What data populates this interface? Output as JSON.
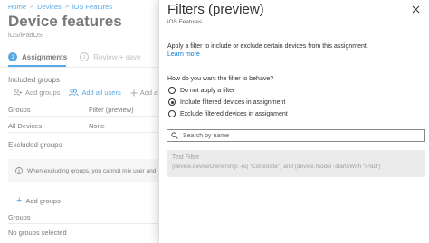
{
  "breadcrumb": [
    "Home",
    "Devices",
    "iOS Features"
  ],
  "page": {
    "title": "Device features",
    "more": "...",
    "subtitle": "iOS/iPadOS"
  },
  "steps": [
    {
      "num": "1",
      "label": "Assignments"
    },
    {
      "num": "2",
      "label": "Review + save"
    }
  ],
  "included": {
    "label": "Included groups",
    "actions": [
      "Add groups",
      "Add all users",
      "Add all d"
    ],
    "columns": [
      "Groups",
      "Filter (preview)"
    ],
    "rows": [
      {
        "group": "All Devices",
        "filter": "None"
      }
    ]
  },
  "excluded": {
    "label": "Excluded groups",
    "info": "When excluding groups, you cannot mix user and",
    "add": "Add groups",
    "column": "Groups",
    "empty": "No groups selected"
  },
  "panel": {
    "title": "Filters (preview)",
    "subtitle": "iOS Features",
    "description": "Apply a filter to include or exclude certain devices from this assignment.",
    "learn_more": "Learn more",
    "question": "How do you want the filter to behave?",
    "options": [
      "Do not apply a filter",
      "Include filtered devices in assignment",
      "Exclude filtered devices in assignment"
    ],
    "selected_option": 1,
    "search_placeholder": "Search by name",
    "filter": {
      "name": "Test Filter",
      "rule": "(device.deviceOwnership -eq \"Corporate\") and (device.model -startsWith \"iPad\")"
    }
  },
  "colors": {
    "accent": "#0078d4",
    "text": "#323130",
    "muted": "#605e5c",
    "disabled": "#a19f9d"
  }
}
